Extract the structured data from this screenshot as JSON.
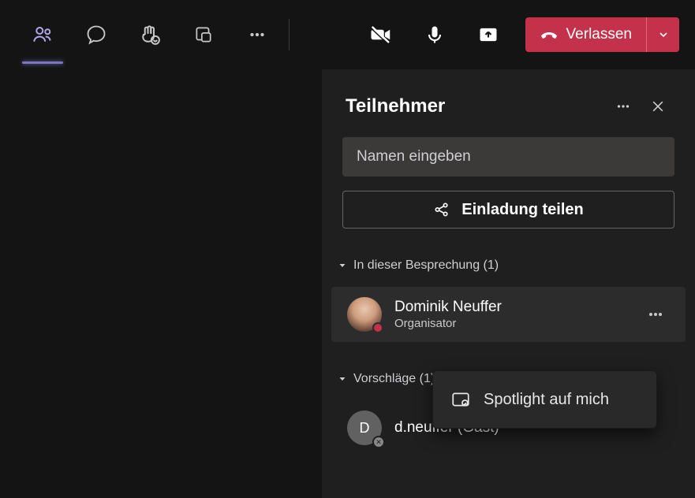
{
  "toolbar": {
    "leave_label": "Verlassen"
  },
  "panel": {
    "title": "Teilnehmer",
    "search_placeholder": "Namen eingeben",
    "share_invite_label": "Einladung teilen",
    "section_meeting": "In dieser Besprechung (1)",
    "section_suggestions": "Vorschläge (1)"
  },
  "participants": {
    "meeting": [
      {
        "name": "Dominik Neuffer",
        "role": "Organisator",
        "presence": "busy"
      }
    ],
    "suggestions": [
      {
        "initial": "D",
        "name": "d.neuffer (Gast)"
      }
    ]
  },
  "context_menu": {
    "spotlight_label": "Spotlight auf mich"
  }
}
